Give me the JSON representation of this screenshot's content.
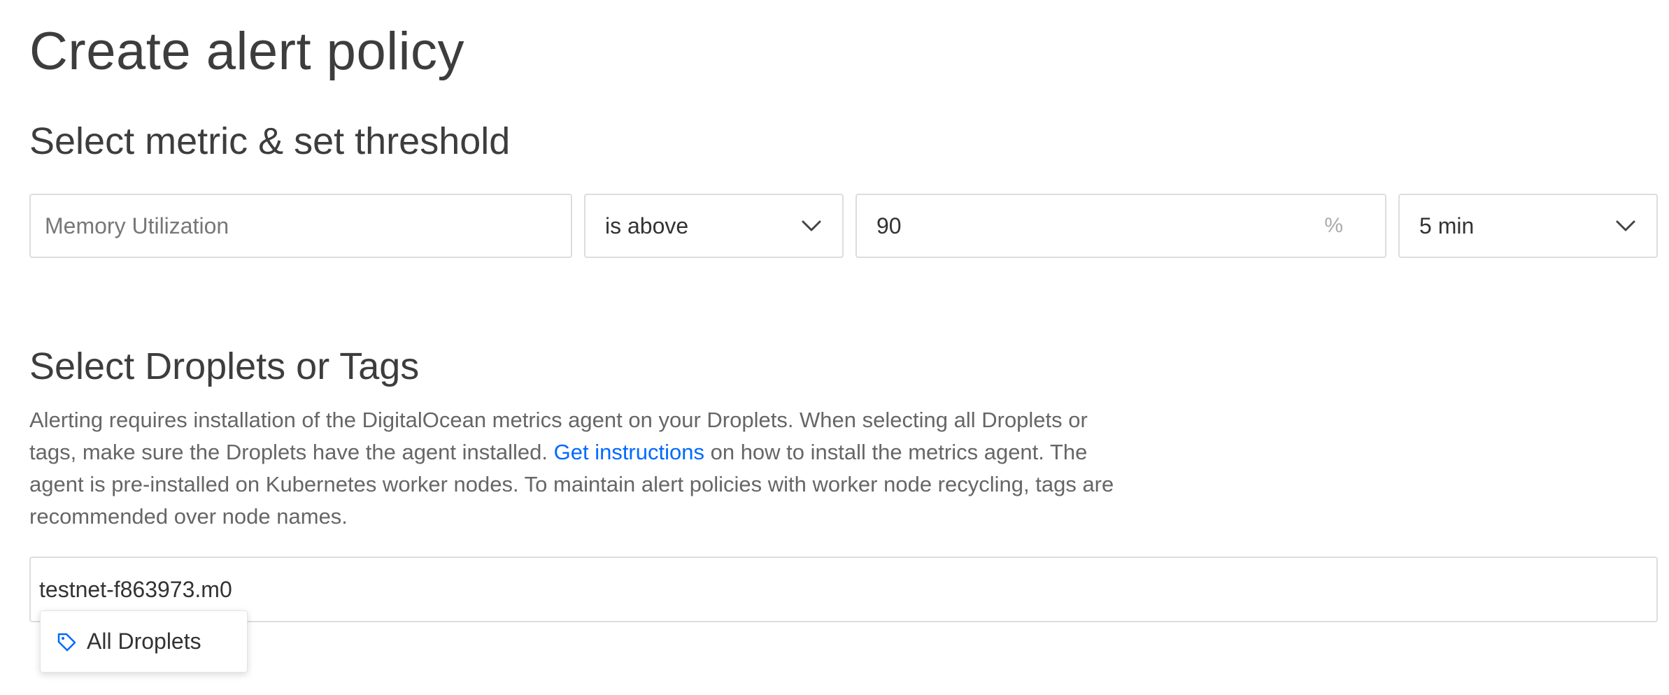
{
  "page": {
    "title": "Create alert policy"
  },
  "metric_section": {
    "title": "Select metric & set threshold",
    "metric_placeholder": "Memory Utilization",
    "operator": "is above",
    "threshold_value": "90",
    "threshold_unit": "%",
    "window": "5 min"
  },
  "targets_section": {
    "title": "Select Droplets or Tags",
    "description_part1": "Alerting requires installation of the DigitalOcean metrics agent on your Droplets. When selecting all Droplets or tags, make sure the Droplets have the agent installed. ",
    "description_link": "Get instructions",
    "description_part2": " on how to install the metrics agent. The agent is pre-installed on Kubernetes worker nodes. To maintain alert policies with worker node recycling, tags are recommended over node names.",
    "input_value": "testnet-f863973.m0",
    "suggestion_label": "All Droplets"
  },
  "colors": {
    "link": "#0069ff",
    "border": "#dddddd",
    "text": "#3d3d3d"
  },
  "icons": {
    "select_chevron": "chevron-down-icon",
    "suggestion": "tag-icon"
  }
}
